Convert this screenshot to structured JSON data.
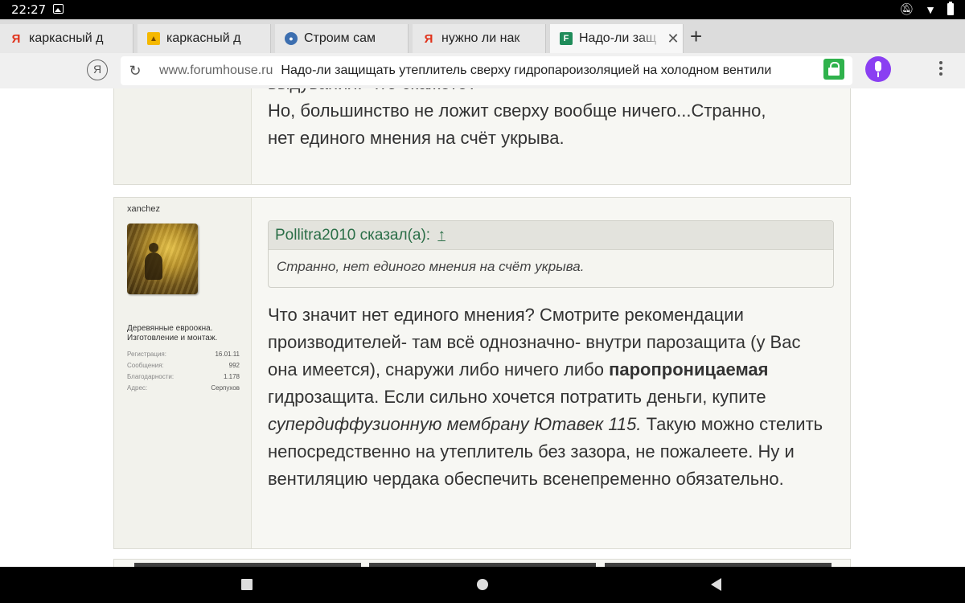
{
  "status_bar": {
    "time": "22:27"
  },
  "tabs": [
    {
      "favicon": "yandex-icon",
      "title": "каркасный д",
      "active": false
    },
    {
      "favicon": "image-icon",
      "title": "каркасный д",
      "active": false
    },
    {
      "favicon": "build-site-icon",
      "title": "Строим сам",
      "active": false
    },
    {
      "favicon": "yandex-icon",
      "title": "нужно ли нак",
      "active": false
    },
    {
      "favicon": "forumhouse-icon",
      "title": "Надо-ли защ",
      "active": true
    }
  ],
  "new_tab_label": "+",
  "address_bar": {
    "yandex_button": "Я",
    "domain": "www.forumhouse.ru",
    "page_title": "Надо-ли защищать утеплитель сверху гидропароизоляцией на холодном вентили"
  },
  "prev_post": {
    "line_cut": "выдувания. Что скажете?",
    "line1": "Но, большинство не ложит сверху вообще ничего...Странно,",
    "line2": "нет единого мнения на счёт укрыва."
  },
  "post": {
    "username": "xanchez",
    "signature": "Деревянные евроокна. Изготовление и монтаж.",
    "stats": [
      {
        "key": "Регистрация:",
        "value": "16.01.11"
      },
      {
        "key": "Сообщения:",
        "value": "992"
      },
      {
        "key": "Благодарности:",
        "value": "1.178"
      },
      {
        "key": "Адрес:",
        "value": "Серпухов"
      }
    ],
    "quote": {
      "header": "Pollitra2010 сказал(а):",
      "arrow": "↑",
      "text": "Странно, нет единого мнения на счёт укрыва."
    },
    "body": {
      "p1": "Что значит нет единого мнения? Смотрите рекомендации производителей- там всё однозначно- внутри парозащита (у Вас она имеется), снаружи либо ничего либо ",
      "bold": "паропроницаемая",
      "p2": " гидрозащита. Если сильно хочется потратить деньги, купите ",
      "italic": "супердиффузионную мембрану Ютавек 115.",
      "p3": " Такую можно стелить непосредственно на утеплитель без зазора, не пожалеете. Ну и вентиляцию чердака обеспечить всенепременно обязательно."
    }
  },
  "colors": {
    "quote_header_text": "#2a6e47",
    "lock_green": "#2fb24c",
    "mic_purple": "#8a3ff2"
  }
}
